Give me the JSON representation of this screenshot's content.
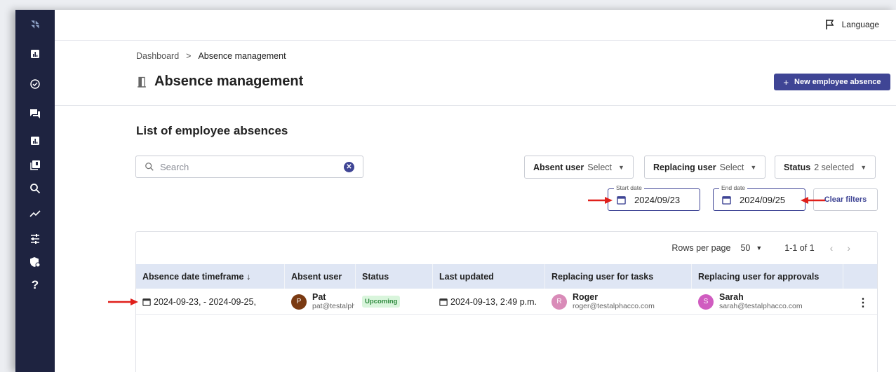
{
  "header": {
    "language_label": "Language"
  },
  "breadcrumb": {
    "root": "Dashboard",
    "separator": ">",
    "current": "Absence management"
  },
  "page": {
    "title": "Absence management",
    "new_button": "New employee absence",
    "new_button_icon": "+"
  },
  "section": {
    "title": "List of employee absences"
  },
  "search": {
    "placeholder": "Search"
  },
  "filters": {
    "absent_user": {
      "label": "Absent user",
      "value": "Select"
    },
    "replacing_user": {
      "label": "Replacing user",
      "value": "Select"
    },
    "status": {
      "label": "Status",
      "value": "2 selected"
    },
    "start_date": {
      "legend": "Start date",
      "value": "2024/09/23"
    },
    "end_date": {
      "legend": "End date",
      "value": "2024/09/25"
    },
    "clear_label": "Clear filters"
  },
  "pagination": {
    "rows_label": "Rows per page",
    "rows_value": "50",
    "range": "1-1 of 1",
    "prev": "‹",
    "next": "›"
  },
  "table": {
    "columns": [
      "Absence date timeframe ↓",
      "Absent user",
      "Status",
      "Last updated",
      "Replacing user for tasks",
      "Replacing user for approvals"
    ],
    "rows": [
      {
        "timeframe": "2024-09-23, - 2024-09-25,",
        "absent_user": {
          "initial": "P",
          "name": "Pat",
          "email": "pat@testalphacco.com",
          "color": "#7a3a12"
        },
        "status": "Upcoming",
        "last_updated": "2024-09-13, 2:49 p.m.",
        "task_user": {
          "initial": "R",
          "name": "Roger",
          "email": "roger@testalphacco.com",
          "color": "#d98bb8"
        },
        "approval_user": {
          "initial": "S",
          "name": "Sarah",
          "email": "sarah@testalphacco.com",
          "color": "#d05cc0"
        }
      }
    ]
  },
  "sidebar": {
    "icons": [
      "logo-icon",
      "dashboard-icon",
      "tasks-check-icon",
      "messages-icon",
      "reports-icon",
      "library-icon",
      "search-icon",
      "analytics-trend-icon",
      "settings-sliders-icon",
      "security-shield-icon",
      "help-question-icon"
    ]
  },
  "colors": {
    "sidebar": "#1e2340",
    "accent": "#3f4595",
    "table_header": "#dfe6f4",
    "badge_bg": "#d9f5dc",
    "annotation_arrow": "#e0201b"
  }
}
